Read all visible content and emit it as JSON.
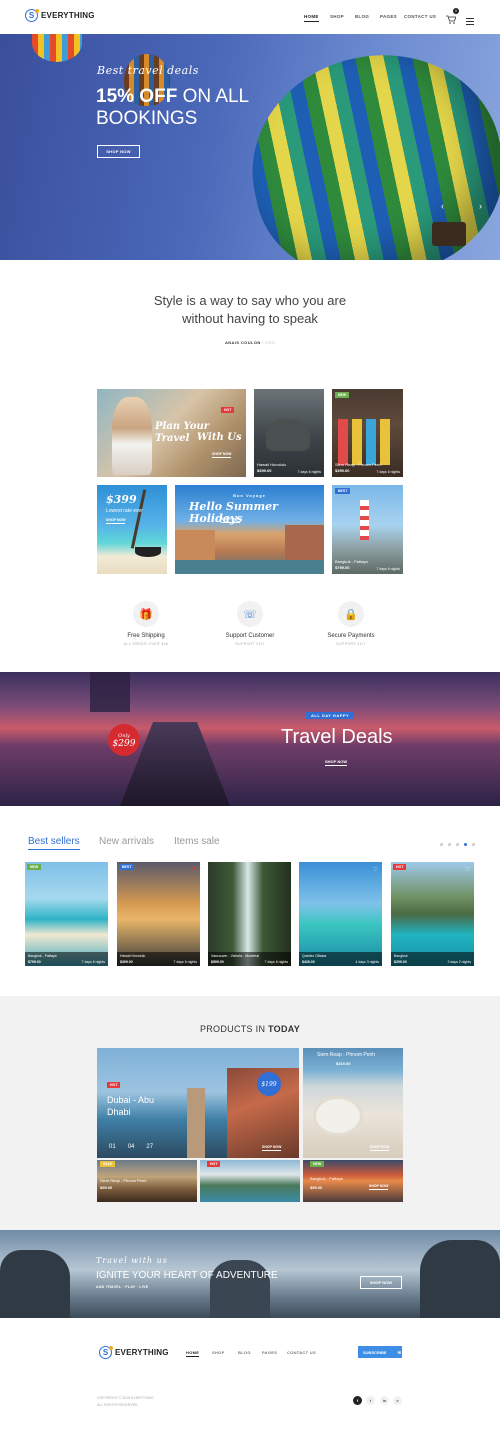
{
  "header": {
    "logo_text": "EVERYTHING",
    "logo_letter": "S",
    "nav": [
      "HOME",
      "SHOP",
      "BLOG",
      "PAGES",
      "CONTACT US"
    ],
    "cart_count": "0"
  },
  "hero": {
    "script": "Best travel deals",
    "headline_bold": "15% OFF",
    "headline_rest": " ON ALL BOOKINGS",
    "button": "SHOP NOW",
    "prev": "‹",
    "next": "›"
  },
  "quote": {
    "line1": "Style is a way to say who you are",
    "line2": "without having to speak",
    "author": "ANAIS COULON",
    "role": " / CEO"
  },
  "tiles": {
    "t1": {
      "badge": "HOT",
      "title": "Plan Your Travel",
      "title2": "With Us",
      "link": "SHOP NOW"
    },
    "t2": {
      "place": "Hawaii Honolulu",
      "price": "$399.00",
      "days": "7 days 6 nights"
    },
    "t3": {
      "badge": "NEW",
      "place": "Siem Reap - Phnom Penh",
      "price": "$399.00",
      "days": "7 days 6 nights"
    },
    "t4": {
      "price": "$399",
      "sub": "Lowest rate ever",
      "link": "SHOP NOW"
    },
    "t5": {
      "eyebrow": "Bon Voyage",
      "title": "Hello Summer Holidays",
      "link": "SHOP NOW"
    },
    "t6": {
      "badge": "BEST",
      "place": "Bangkok - Pattaya",
      "price": "$799.00",
      "days": "7 days 6 nights"
    }
  },
  "features": [
    {
      "title": "Free Shipping",
      "sub": "ALL ORDER OVER $48"
    },
    {
      "title": "Support Customer",
      "sub": "SUPPORT 24/7"
    },
    {
      "title": "Secure Payments",
      "sub": "SUPPORT 24/7"
    }
  ],
  "deals": {
    "price_label": "Only",
    "price": "$299",
    "tag": "ALL DAY HAPPY",
    "title": "Travel Deals",
    "link": "SHOP NOW"
  },
  "tabs": [
    "Best sellers",
    "New arrivals",
    "Items sale"
  ],
  "cards": [
    {
      "badge": "NEW",
      "place": "Bangkok - Pattaya",
      "price": "$799.00",
      "days": "7 days 6 nights"
    },
    {
      "badge": "BEST",
      "place": "Hawaii Honolulu",
      "price": "$399.00",
      "days": "7 days 6 nights"
    },
    {
      "badge": "",
      "place": "Vancouver - Victoria - Montreal",
      "price": "$599.00",
      "days": "7 days 6 nights"
    },
    {
      "badge": "",
      "place": "Quebec Ottawa",
      "price": "$426.00",
      "days": "4 days 3 nights"
    },
    {
      "badge": "HOT",
      "place": "Bangkok",
      "price": "$299.00",
      "days": "3 days 2 nights"
    }
  ],
  "today": {
    "title_light": "PRODUCTS IN ",
    "title_bold": "TODAY",
    "main": {
      "badge": "HOT",
      "place": "Dubai - Abu Dhabi",
      "price": "$199",
      "d": "01",
      "h": "04",
      "m": "27",
      "link": "SHOP NOW"
    },
    "top_right": {
      "place": "Siem Reap - Phnom Penh",
      "price": "$219.00",
      "link": "SHOP NOW"
    },
    "b1": {
      "badge": "SALE",
      "place": "Siem Reap - Phnom Penh",
      "price": "$99.00"
    },
    "b2": {
      "badge": "HOT"
    },
    "b3": {
      "badge": "NEW",
      "place": "Bangkok - Pattaya",
      "price": "$99.00",
      "link": "SHOP NOW"
    }
  },
  "adventure": {
    "script": "Travel with us",
    "title": "IGNITE YOUR HEART OF ADVENTURE",
    "sub": "AND TRAVEL · PLAY · LIVE",
    "button": "SHOP NOW"
  },
  "footer": {
    "logo_text": "EVERYTHING",
    "logo_letter": "S",
    "nav": [
      "HOME",
      "SHOP",
      "BLOG",
      "PAGES",
      "CONTACT US"
    ],
    "subscribe": "SUBSCRIBE",
    "copy1": "COPYRIGHT © 2018 EVERYTHING",
    "copy2": "ALL RIGHTS RESERVED",
    "social": [
      "f",
      "t",
      "in",
      "v"
    ]
  },
  "colors": {
    "accent": "#2f6fd6",
    "hot": "#e5393b",
    "new": "#6ab04c"
  }
}
